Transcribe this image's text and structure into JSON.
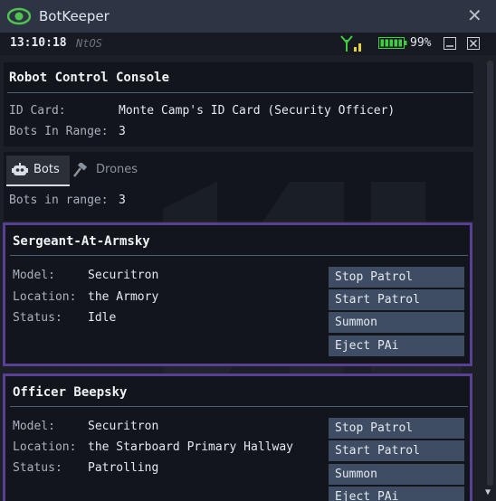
{
  "window": {
    "title": "BotKeeper",
    "close_label": "✕"
  },
  "statusbar": {
    "time": "13:10:18",
    "os": "NtOS",
    "battery": "99%"
  },
  "console": {
    "title": "Robot Control Console",
    "id_card_label": "ID Card:",
    "id_card_value": "Monte Camp's ID Card (Security Officer)",
    "bots_in_range_label": "Bots In Range:",
    "bots_in_range_value": "3"
  },
  "tabs": {
    "bots": "Bots",
    "drones": "Drones",
    "bots_in_range_label": "Bots in range:",
    "bots_in_range_value": "3"
  },
  "bots": [
    {
      "name": "Sergeant-At-Armsky",
      "model_label": "Model:",
      "model": "Securitron",
      "location_label": "Location:",
      "location": "the Armory",
      "status_label": "Status:",
      "status": "Idle",
      "buttons": [
        "Stop Patrol",
        "Start Patrol",
        "Summon",
        "Eject PAi"
      ]
    },
    {
      "name": "Officer Beepsky",
      "model_label": "Model:",
      "model": "Securitron",
      "location_label": "Location:",
      "location": "the Starboard Primary Hallway",
      "status_label": "Status:",
      "status": "Patrolling",
      "buttons": [
        "Stop Patrol",
        "Start Patrol",
        "Summon",
        "Eject PAi"
      ]
    }
  ],
  "colors": {
    "accent_border": "#5a3f96",
    "button_bg": "#3e4d63",
    "battery_green": "#3ecf3e",
    "signal_green": "#3ecf3e",
    "signal_yellow": "#e6d23a"
  }
}
